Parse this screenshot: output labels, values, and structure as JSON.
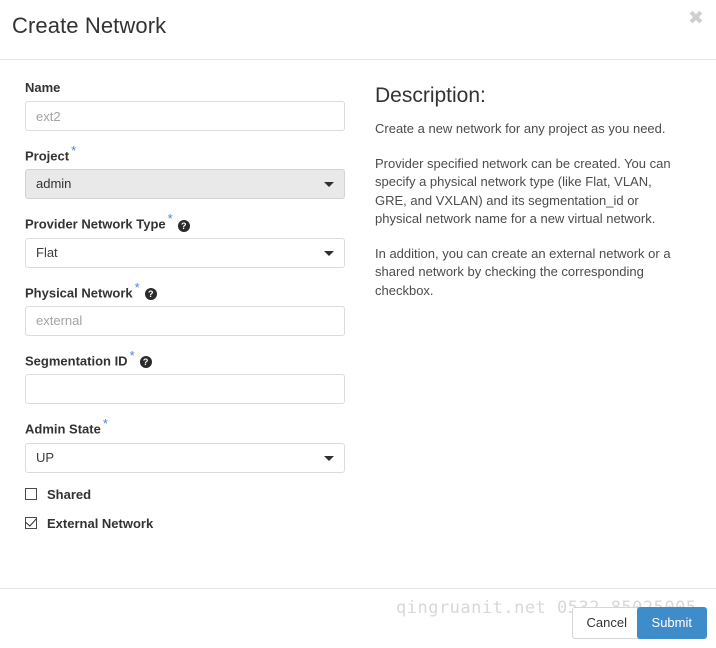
{
  "dialog": {
    "title": "Create Network",
    "close_icon": "close-icon",
    "close_glyph": "✖"
  },
  "form": {
    "fields": [
      {
        "name": "name",
        "label": "Name",
        "required": false,
        "help": false,
        "type": "text",
        "value": "",
        "placeholder": "ext2"
      },
      {
        "name": "project",
        "label": "Project",
        "required": true,
        "help": false,
        "type": "select",
        "value": "admin",
        "disabled": true
      },
      {
        "name": "provider-network-type",
        "label": "Provider Network Type",
        "required": true,
        "help": true,
        "type": "select",
        "value": "Flat",
        "disabled": false
      },
      {
        "name": "physical-network",
        "label": "Physical Network",
        "required": true,
        "help": true,
        "type": "text",
        "value": "",
        "placeholder": "external"
      },
      {
        "name": "segmentation-id",
        "label": "Segmentation ID",
        "required": true,
        "help": true,
        "type": "text",
        "value": "",
        "placeholder": ""
      },
      {
        "name": "admin-state",
        "label": "Admin State",
        "required": true,
        "help": false,
        "type": "select",
        "value": "UP",
        "disabled": false
      }
    ],
    "required_marker": "*",
    "help_glyph": "?",
    "checkboxes": [
      {
        "name": "shared",
        "label": "Shared",
        "checked": false
      },
      {
        "name": "external-network",
        "label": "External Network",
        "checked": true
      }
    ]
  },
  "description": {
    "title": "Description:",
    "paragraphs": [
      "Create a new network for any project as you need.",
      "Provider specified network can be created. You can specify a physical network type (like Flat, VLAN, GRE, and VXLAN) and its segmentation_id or physical network name for a new virtual network.",
      "In addition, you can create an external network or a shared network by checking the corresponding checkbox."
    ]
  },
  "watermark": {
    "text": "qingruanit.net 0532-85025005"
  },
  "footer": {
    "cancel_label": "Cancel",
    "submit_label": "Submit"
  },
  "colors": {
    "accent_blue": "#3f8ccb",
    "required_star": "#4a87d0",
    "disabled_select_bg": "#e9e9e9",
    "border": "#dcdcdc",
    "watermark": "#d8d8d8"
  }
}
